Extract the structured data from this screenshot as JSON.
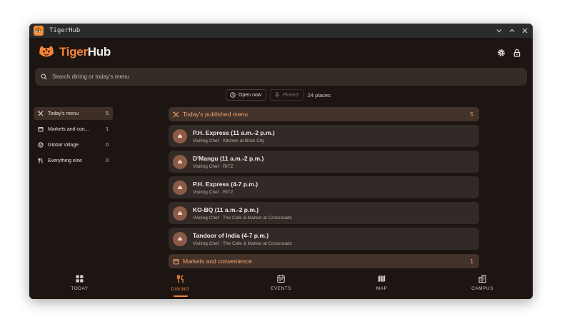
{
  "window": {
    "title": "TigerHub",
    "minimize_icon": "chevron-down",
    "maximize_icon": "chevron-up",
    "close_icon": "close"
  },
  "header": {
    "brand_part1": "Tiger",
    "brand_part2": "Hub",
    "settings_icon": "gear",
    "lock_icon": "lock"
  },
  "search": {
    "placeholder": "Search dining or today's menu"
  },
  "filters": {
    "open_now": "Open now",
    "pinned": "Pinned",
    "count": "24 places"
  },
  "sidebar": {
    "items": [
      {
        "label": "Today's menu",
        "count": "5",
        "icon": "utensils-cross",
        "active": true
      },
      {
        "label": "Markets and con...",
        "count": "1",
        "icon": "store"
      },
      {
        "label": "Global Village",
        "count": "0",
        "icon": "globe"
      },
      {
        "label": "Everything else",
        "count": "0",
        "icon": "fork-knife"
      }
    ]
  },
  "main": {
    "section1": {
      "title": "Today's published menu",
      "count": "5"
    },
    "cards": [
      {
        "name": "P.H. Express (11 a.m.-2 p.m.)",
        "sub": "Visiting Chef · Kitchen at Brick City"
      },
      {
        "name": "D'Mangu (11 a.m.-2 p.m.)",
        "sub": "Visiting Chef · RITZ"
      },
      {
        "name": "P.H. Express (4-7 p.m.)",
        "sub": "Visiting Chef · RITZ"
      },
      {
        "name": "KO-BQ (11 a.m.-2 p.m.)",
        "sub": "Visiting Chef · The Cafe & Market at Crossroads"
      },
      {
        "name": "Tandoor of India (4-7 p.m.)",
        "sub": "Visiting Chef · The Cafe & Market at Crossroads"
      }
    ],
    "section2": {
      "title": "Markets and convenience",
      "count": "1"
    }
  },
  "nav": {
    "tabs": [
      {
        "label": "TODAY",
        "icon": "grid"
      },
      {
        "label": "DINING",
        "icon": "fork-knife",
        "active": true
      },
      {
        "label": "EVENTS",
        "icon": "calendar"
      },
      {
        "label": "MAP",
        "icon": "map"
      },
      {
        "label": "CAMPUS",
        "icon": "building"
      }
    ]
  },
  "colors": {
    "accent": "#f2853a",
    "background": "#1c1512",
    "card": "#322a26",
    "section": "#43322a"
  }
}
